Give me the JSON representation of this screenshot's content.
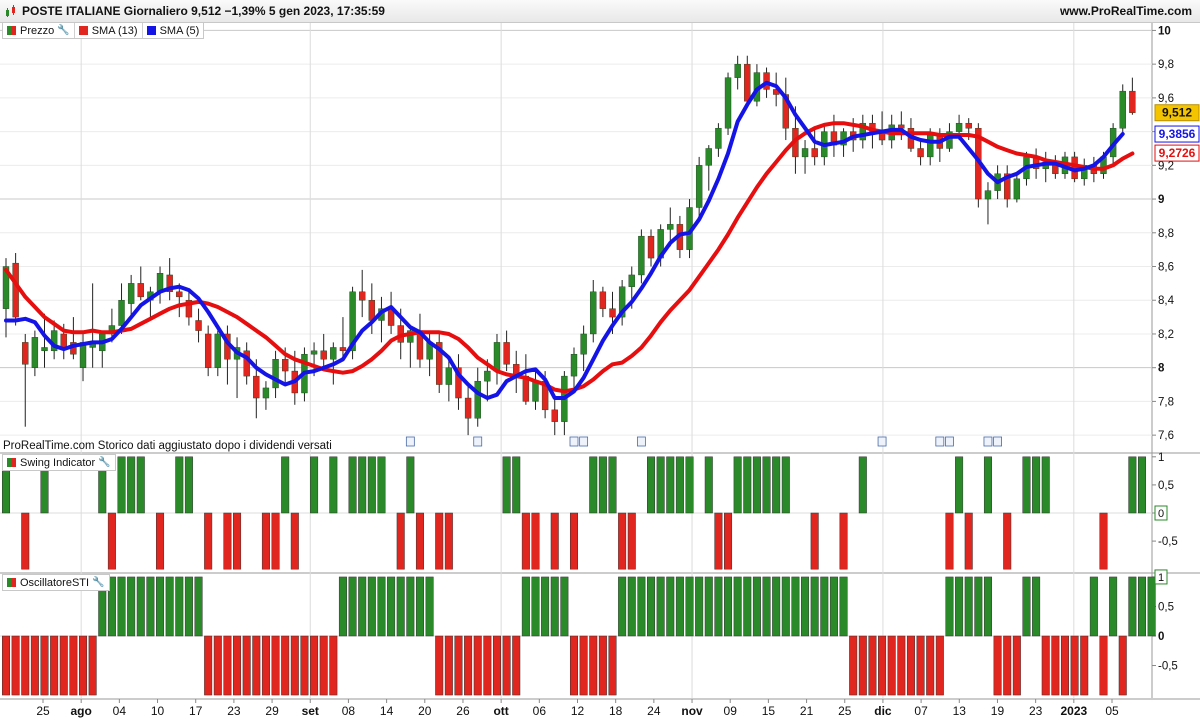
{
  "header": {
    "title": "POSTE ITALIANE Giornaliero 9,512 −1,39% 5 gen 2023, 17:35:59",
    "site": "www.ProRealTime.com"
  },
  "price_legend": {
    "prezzo": "Prezzo",
    "sma13": "SMA (13)",
    "sma5": "SMA (5)"
  },
  "swing_legend": "Swing Indicator",
  "oscillator_legend": "OscillatoreSTI",
  "note": "ProRealTime.com  Storico dati aggiustato dopo i dividendi versati",
  "colors": {
    "up": "#2a8a2a",
    "down": "#e0261e",
    "sma13": "#e60e0e",
    "sma5": "#1414e6",
    "last_price_bg": "#f5c400"
  },
  "icons": [
    "app-icon",
    "wrench-icon",
    "dividend-icon"
  ],
  "chart_data": [
    {
      "type": "candlestick",
      "name": "Prezzo",
      "y_ticks": [
        "7,6",
        "7,8",
        "8",
        "8,2",
        "8,4",
        "8,6",
        "8,8",
        "9",
        "9,2",
        "9,4",
        "9,6",
        "9,8",
        "10"
      ],
      "ylim": [
        7.5,
        10.05
      ],
      "x_ticks": [
        "25",
        "ago",
        "04",
        "10",
        "17",
        "23",
        "29",
        "set",
        "08",
        "14",
        "20",
        "26",
        "ott",
        "06",
        "12",
        "18",
        "24",
        "nov",
        "09",
        "15",
        "21",
        "25",
        "dic",
        "07",
        "13",
        "19",
        "23",
        "2023",
        "05"
      ],
      "last_value_labels": {
        "price": "9,512",
        "sma5": "9,3856",
        "sma13": "9,2726"
      },
      "dividend_markers": 10,
      "ohlc": [
        [
          8.35,
          8.65,
          8.18,
          8.6
        ],
        [
          8.62,
          8.68,
          8.25,
          8.3
        ],
        [
          8.15,
          8.2,
          7.65,
          8.02
        ],
        [
          8.0,
          8.22,
          7.95,
          8.18
        ],
        [
          8.1,
          8.32,
          8.0,
          8.12
        ],
        [
          8.1,
          8.28,
          8.05,
          8.22
        ],
        [
          8.2,
          8.26,
          8.05,
          8.12
        ],
        [
          8.15,
          8.3,
          8.05,
          8.08
        ],
        [
          8.0,
          8.22,
          7.92,
          8.15
        ],
        [
          8.12,
          8.5,
          8.0,
          8.15
        ],
        [
          8.1,
          8.2,
          8.0,
          8.2
        ],
        [
          8.2,
          8.35,
          8.15,
          8.25
        ],
        [
          8.25,
          8.5,
          8.2,
          8.4
        ],
        [
          8.38,
          8.55,
          8.3,
          8.5
        ],
        [
          8.5,
          8.6,
          8.4,
          8.42
        ],
        [
          8.4,
          8.48,
          8.3,
          8.45
        ],
        [
          8.45,
          8.6,
          8.38,
          8.56
        ],
        [
          8.55,
          8.65,
          8.4,
          8.45
        ],
        [
          8.45,
          8.5,
          8.3,
          8.42
        ],
        [
          8.4,
          8.45,
          8.25,
          8.3
        ],
        [
          8.28,
          8.35,
          8.15,
          8.22
        ],
        [
          8.2,
          8.25,
          7.95,
          8.0
        ],
        [
          8.0,
          8.22,
          7.95,
          8.2
        ],
        [
          8.2,
          8.25,
          7.9,
          8.05
        ],
        [
          8.05,
          8.18,
          7.82,
          8.12
        ],
        [
          8.1,
          8.15,
          7.9,
          7.95
        ],
        [
          7.95,
          8.05,
          7.7,
          7.82
        ],
        [
          7.82,
          7.92,
          7.75,
          7.88
        ],
        [
          7.88,
          8.1,
          7.82,
          8.05
        ],
        [
          8.05,
          8.12,
          7.9,
          7.98
        ],
        [
          7.98,
          8.1,
          7.78,
          7.85
        ],
        [
          7.85,
          8.12,
          7.8,
          8.08
        ],
        [
          8.08,
          8.15,
          7.95,
          8.1
        ],
        [
          8.1,
          8.2,
          8.0,
          8.05
        ],
        [
          8.05,
          8.15,
          7.9,
          8.12
        ],
        [
          8.12,
          8.3,
          8.05,
          8.1
        ],
        [
          8.1,
          8.48,
          8.05,
          8.45
        ],
        [
          8.45,
          8.58,
          8.3,
          8.4
        ],
        [
          8.4,
          8.5,
          8.2,
          8.28
        ],
        [
          8.28,
          8.42,
          8.15,
          8.35
        ],
        [
          8.35,
          8.45,
          8.2,
          8.25
        ],
        [
          8.25,
          8.35,
          8.05,
          8.15
        ],
        [
          8.15,
          8.25,
          8.0,
          8.22
        ],
        [
          8.22,
          8.32,
          8.0,
          8.05
        ],
        [
          8.05,
          8.2,
          7.95,
          8.15
        ],
        [
          8.15,
          8.2,
          7.85,
          7.9
        ],
        [
          7.9,
          8.05,
          7.8,
          8.0
        ],
        [
          8.0,
          8.08,
          7.75,
          7.82
        ],
        [
          7.82,
          7.9,
          7.6,
          7.7
        ],
        [
          7.7,
          8.0,
          7.65,
          7.92
        ],
        [
          7.92,
          8.05,
          7.8,
          7.98
        ],
        [
          7.98,
          8.2,
          7.9,
          8.15
        ],
        [
          8.15,
          8.22,
          7.98,
          8.02
        ],
        [
          8.02,
          8.1,
          7.85,
          7.95
        ],
        [
          7.95,
          8.08,
          7.78,
          7.8
        ],
        [
          7.8,
          7.98,
          7.75,
          7.92
        ],
        [
          7.92,
          7.98,
          7.7,
          7.75
        ],
        [
          7.75,
          7.82,
          7.6,
          7.68
        ],
        [
          7.68,
          7.98,
          7.6,
          7.95
        ],
        [
          7.95,
          8.12,
          7.88,
          8.08
        ],
        [
          8.08,
          8.25,
          7.98,
          8.2
        ],
        [
          8.2,
          8.52,
          8.15,
          8.45
        ],
        [
          8.45,
          8.48,
          8.3,
          8.35
        ],
        [
          8.35,
          8.45,
          8.2,
          8.3
        ],
        [
          8.3,
          8.52,
          8.25,
          8.48
        ],
        [
          8.48,
          8.6,
          8.35,
          8.55
        ],
        [
          8.55,
          8.82,
          8.5,
          8.78
        ],
        [
          8.78,
          8.82,
          8.6,
          8.65
        ],
        [
          8.65,
          8.85,
          8.6,
          8.82
        ],
        [
          8.82,
          8.95,
          8.72,
          8.85
        ],
        [
          8.85,
          8.9,
          8.65,
          8.7
        ],
        [
          8.7,
          9.0,
          8.65,
          8.95
        ],
        [
          8.95,
          9.25,
          8.9,
          9.2
        ],
        [
          9.2,
          9.32,
          9.05,
          9.3
        ],
        [
          9.3,
          9.45,
          9.25,
          9.42
        ],
        [
          9.42,
          9.75,
          9.38,
          9.72
        ],
        [
          9.72,
          9.85,
          9.65,
          9.8
        ],
        [
          9.8,
          9.85,
          9.55,
          9.58
        ],
        [
          9.58,
          9.8,
          9.55,
          9.75
        ],
        [
          9.75,
          9.78,
          9.6,
          9.65
        ],
        [
          9.65,
          9.75,
          9.55,
          9.62
        ],
        [
          9.62,
          9.72,
          9.35,
          9.42
        ],
        [
          9.42,
          9.55,
          9.15,
          9.25
        ],
        [
          9.25,
          9.35,
          9.15,
          9.3
        ],
        [
          9.3,
          9.42,
          9.2,
          9.25
        ],
        [
          9.25,
          9.45,
          9.2,
          9.4
        ],
        [
          9.4,
          9.5,
          9.25,
          9.32
        ],
        [
          9.32,
          9.42,
          9.25,
          9.4
        ],
        [
          9.4,
          9.48,
          9.28,
          9.35
        ],
        [
          9.35,
          9.5,
          9.3,
          9.45
        ],
        [
          9.45,
          9.5,
          9.3,
          9.4
        ],
        [
          9.4,
          9.52,
          9.32,
          9.35
        ],
        [
          9.35,
          9.5,
          9.3,
          9.44
        ],
        [
          9.44,
          9.52,
          9.35,
          9.42
        ],
        [
          9.42,
          9.48,
          9.28,
          9.3
        ],
        [
          9.3,
          9.35,
          9.2,
          9.25
        ],
        [
          9.25,
          9.42,
          9.2,
          9.38
        ],
        [
          9.38,
          9.42,
          9.22,
          9.3
        ],
        [
          9.3,
          9.45,
          9.28,
          9.4
        ],
        [
          9.4,
          9.5,
          9.35,
          9.45
        ],
        [
          9.45,
          9.48,
          9.35,
          9.42
        ],
        [
          9.42,
          9.45,
          8.95,
          9.0
        ],
        [
          9.0,
          9.1,
          8.85,
          9.05
        ],
        [
          9.05,
          9.2,
          9.0,
          9.15
        ],
        [
          9.15,
          9.2,
          8.95,
          9.0
        ],
        [
          9.0,
          9.15,
          8.98,
          9.12
        ],
        [
          9.12,
          9.28,
          9.08,
          9.25
        ],
        [
          9.25,
          9.3,
          9.12,
          9.18
        ],
        [
          9.18,
          9.28,
          9.1,
          9.22
        ],
        [
          9.22,
          9.26,
          9.12,
          9.15
        ],
        [
          9.15,
          9.28,
          9.12,
          9.25
        ],
        [
          9.25,
          9.28,
          9.1,
          9.12
        ],
        [
          9.12,
          9.24,
          9.08,
          9.2
        ],
        [
          9.2,
          9.25,
          9.1,
          9.15
        ],
        [
          9.15,
          9.28,
          9.12,
          9.25
        ],
        [
          9.25,
          9.45,
          9.2,
          9.42
        ],
        [
          9.42,
          9.68,
          9.38,
          9.64
        ],
        [
          9.64,
          9.72,
          9.5,
          9.512
        ]
      ],
      "sma13": [
        8.58,
        8.5,
        8.42,
        8.36,
        8.3,
        8.26,
        8.22,
        8.21,
        8.21,
        8.22,
        8.21,
        8.21,
        8.22,
        8.23,
        8.26,
        8.29,
        8.32,
        8.35,
        8.37,
        8.38,
        8.39,
        8.38,
        8.36,
        8.33,
        8.3,
        8.26,
        8.22,
        8.18,
        8.13,
        8.08,
        8.05,
        8.03,
        8.01,
        7.99,
        7.98,
        7.97,
        7.98,
        8.01,
        8.05,
        8.1,
        8.16,
        8.19,
        8.2,
        8.21,
        8.21,
        8.21,
        8.2,
        8.17,
        8.12,
        8.06,
        8.02,
        7.98,
        7.96,
        7.95,
        7.94,
        7.92,
        7.9,
        7.87,
        7.86,
        7.87,
        7.89,
        7.93,
        7.98,
        8.02,
        8.03,
        8.07,
        8.12,
        8.19,
        8.27,
        8.34,
        8.4,
        8.46,
        8.54,
        8.62,
        8.7,
        8.79,
        8.89,
        8.98,
        9.07,
        9.15,
        9.22,
        9.29,
        9.35,
        9.39,
        9.42,
        9.44,
        9.45,
        9.45,
        9.44,
        9.43,
        9.41,
        9.4,
        9.39,
        9.39,
        9.39,
        9.39,
        9.39,
        9.38,
        9.38,
        9.38,
        9.38,
        9.37,
        9.34,
        9.31,
        9.29,
        9.27,
        9.26,
        9.25,
        9.23,
        9.22,
        9.21,
        9.2,
        9.19,
        9.18,
        9.18,
        9.2,
        9.24,
        9.27
      ],
      "sma5": [
        8.28,
        8.28,
        8.29,
        8.27,
        8.19,
        8.13,
        8.11,
        8.13,
        8.14,
        8.15,
        8.15,
        8.17,
        8.23,
        8.3,
        8.37,
        8.41,
        8.45,
        8.47,
        8.48,
        8.46,
        8.41,
        8.33,
        8.24,
        8.15,
        8.09,
        8.06,
        8.0,
        7.96,
        7.93,
        7.9,
        7.92,
        7.97,
        7.98,
        8.0,
        8.02,
        8.05,
        8.14,
        8.22,
        8.27,
        8.33,
        8.36,
        8.3,
        8.24,
        8.21,
        8.15,
        8.11,
        8.06,
        7.96,
        7.9,
        7.85,
        7.82,
        7.84,
        7.92,
        7.95,
        7.98,
        7.99,
        7.93,
        7.82,
        7.82,
        7.86,
        7.94,
        8.05,
        8.16,
        8.25,
        8.33,
        8.39,
        8.47,
        8.56,
        8.66,
        8.74,
        8.79,
        8.8,
        8.88,
        8.99,
        9.12,
        9.27,
        9.46,
        9.56,
        9.65,
        9.69,
        9.67,
        9.6,
        9.5,
        9.42,
        9.34,
        9.32,
        9.33,
        9.34,
        9.37,
        9.38,
        9.39,
        9.4,
        9.41,
        9.41,
        9.37,
        9.35,
        9.34,
        9.34,
        9.37,
        9.37,
        9.3,
        9.23,
        9.15,
        9.1,
        9.13,
        9.15,
        9.19,
        9.2,
        9.21,
        9.21,
        9.19,
        9.17,
        9.18,
        9.2,
        9.25,
        9.32,
        9.3856
      ]
    },
    {
      "type": "bar",
      "name": "Swing Indicator",
      "y_ticks": [
        "1",
        "0,5",
        "0",
        "-0,5"
      ],
      "ylim": [
        -1.05,
        1.05
      ],
      "last_value_label": "0",
      "values": [
        1,
        0,
        -1,
        0,
        1,
        0,
        0,
        0,
        0,
        0,
        1,
        -1,
        1,
        1,
        1,
        0,
        -1,
        0,
        1,
        1,
        0,
        -1,
        0,
        -1,
        -1,
        0,
        0,
        -1,
        -1,
        1,
        -1,
        0,
        1,
        0,
        1,
        0,
        1,
        1,
        1,
        1,
        0,
        -1,
        1,
        -1,
        0,
        -1,
        -1,
        0,
        0,
        0,
        0,
        0,
        1,
        1,
        -1,
        -1,
        0,
        -1,
        0,
        -1,
        0,
        1,
        1,
        1,
        -1,
        -1,
        0,
        1,
        1,
        1,
        1,
        1,
        0,
        1,
        -1,
        -1,
        1,
        1,
        1,
        1,
        1,
        1,
        0,
        0,
        -1,
        0,
        0,
        -1,
        0,
        1,
        0,
        0,
        0,
        0,
        0,
        0,
        0,
        0,
        -1,
        1,
        -1,
        0,
        1,
        0,
        -1,
        0,
        1,
        1,
        1,
        0,
        0,
        0,
        0,
        0,
        -1,
        0,
        0,
        1,
        1,
        0
      ]
    },
    {
      "type": "bar",
      "name": "OscillatoreSTI",
      "y_ticks": [
        "1",
        "0,5",
        "0",
        "-0,5"
      ],
      "ylim": [
        -1.05,
        1.05
      ],
      "last_value_label": "1",
      "values": [
        -1,
        -1,
        -1,
        -1,
        -1,
        -1,
        -1,
        -1,
        -1,
        -1,
        1,
        1,
        1,
        1,
        1,
        1,
        1,
        1,
        1,
        1,
        1,
        -1,
        -1,
        -1,
        -1,
        -1,
        -1,
        -1,
        -1,
        -1,
        -1,
        -1,
        -1,
        -1,
        -1,
        1,
        1,
        1,
        1,
        1,
        1,
        1,
        1,
        1,
        1,
        -1,
        -1,
        -1,
        -1,
        -1,
        -1,
        -1,
        -1,
        -1,
        1,
        1,
        1,
        1,
        1,
        -1,
        -1,
        -1,
        -1,
        -1,
        1,
        1,
        1,
        1,
        1,
        1,
        1,
        1,
        1,
        1,
        1,
        1,
        1,
        1,
        1,
        1,
        1,
        1,
        1,
        1,
        1,
        1,
        1,
        1,
        -1,
        -1,
        -1,
        -1,
        -1,
        -1,
        -1,
        -1,
        -1,
        -1,
        1,
        1,
        1,
        1,
        1,
        -1,
        -1,
        -1,
        1,
        1,
        -1,
        -1,
        -1,
        -1,
        -1,
        1,
        -1,
        1,
        -1,
        1,
        1,
        1
      ]
    }
  ]
}
